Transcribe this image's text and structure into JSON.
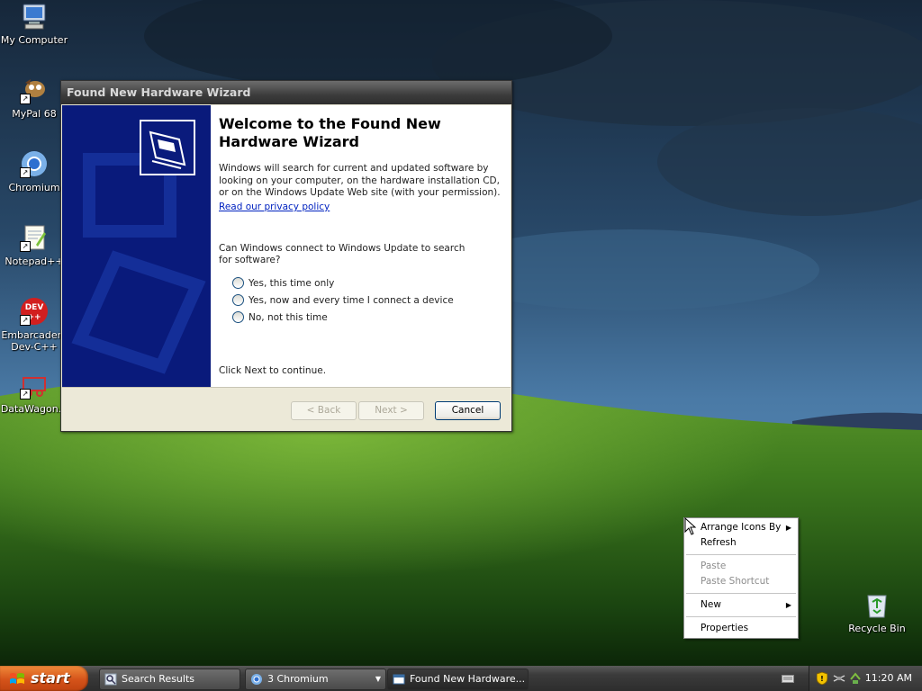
{
  "desktop": {
    "icons": [
      {
        "label": "My Computer",
        "icon": "computer-icon"
      },
      {
        "label": "MyPal 68",
        "icon": "mypal-icon"
      },
      {
        "label": "Chromium",
        "icon": "chromium-icon"
      },
      {
        "label": "Notepad++",
        "icon": "notepadpp-icon"
      },
      {
        "label": "Embarcadero\nDev-C++",
        "icon": "devcpp-icon"
      },
      {
        "label": "DataWagon...",
        "icon": "datawagon-icon"
      },
      {
        "label": "Recycle Bin",
        "icon": "recycle-bin-icon"
      }
    ]
  },
  "wizard": {
    "title": "Found New Hardware Wizard",
    "heading": "Welcome to the Found New Hardware Wizard",
    "description": "Windows will search for current and updated software by looking on your computer, on the hardware installation CD, or on the Windows Update Web site (with your permission).",
    "privacy_link": "Read our privacy policy",
    "question": "Can Windows connect to Windows Update to search for software?",
    "options": [
      "Yes, this time only",
      "Yes, now and every time I connect a device",
      "No, not this time"
    ],
    "hint": "Click Next to continue.",
    "buttons": {
      "back": "< Back",
      "next": "Next >",
      "cancel": "Cancel"
    }
  },
  "context_menu": {
    "items": [
      {
        "label": "Arrange Icons By",
        "submenu": true,
        "enabled": true
      },
      {
        "label": "Refresh",
        "enabled": true
      },
      {
        "label": "Paste",
        "enabled": false
      },
      {
        "label": "Paste Shortcut",
        "enabled": false
      },
      {
        "label": "New",
        "submenu": true,
        "enabled": true
      },
      {
        "label": "Properties",
        "enabled": true
      }
    ]
  },
  "taskbar": {
    "start_label": "start",
    "tasks": [
      {
        "label": "Search Results",
        "icon": "search-results-icon"
      },
      {
        "label": "3 Chromium",
        "icon": "chromium-icon",
        "group": true
      },
      {
        "label": "Found New Hardware...",
        "icon": "window-icon",
        "active": true
      }
    ],
    "clock": "11:20 AM"
  },
  "colors": {
    "wizard_side": "#0a1b7c",
    "start_button": "#d5531a",
    "link": "#0022c0"
  }
}
